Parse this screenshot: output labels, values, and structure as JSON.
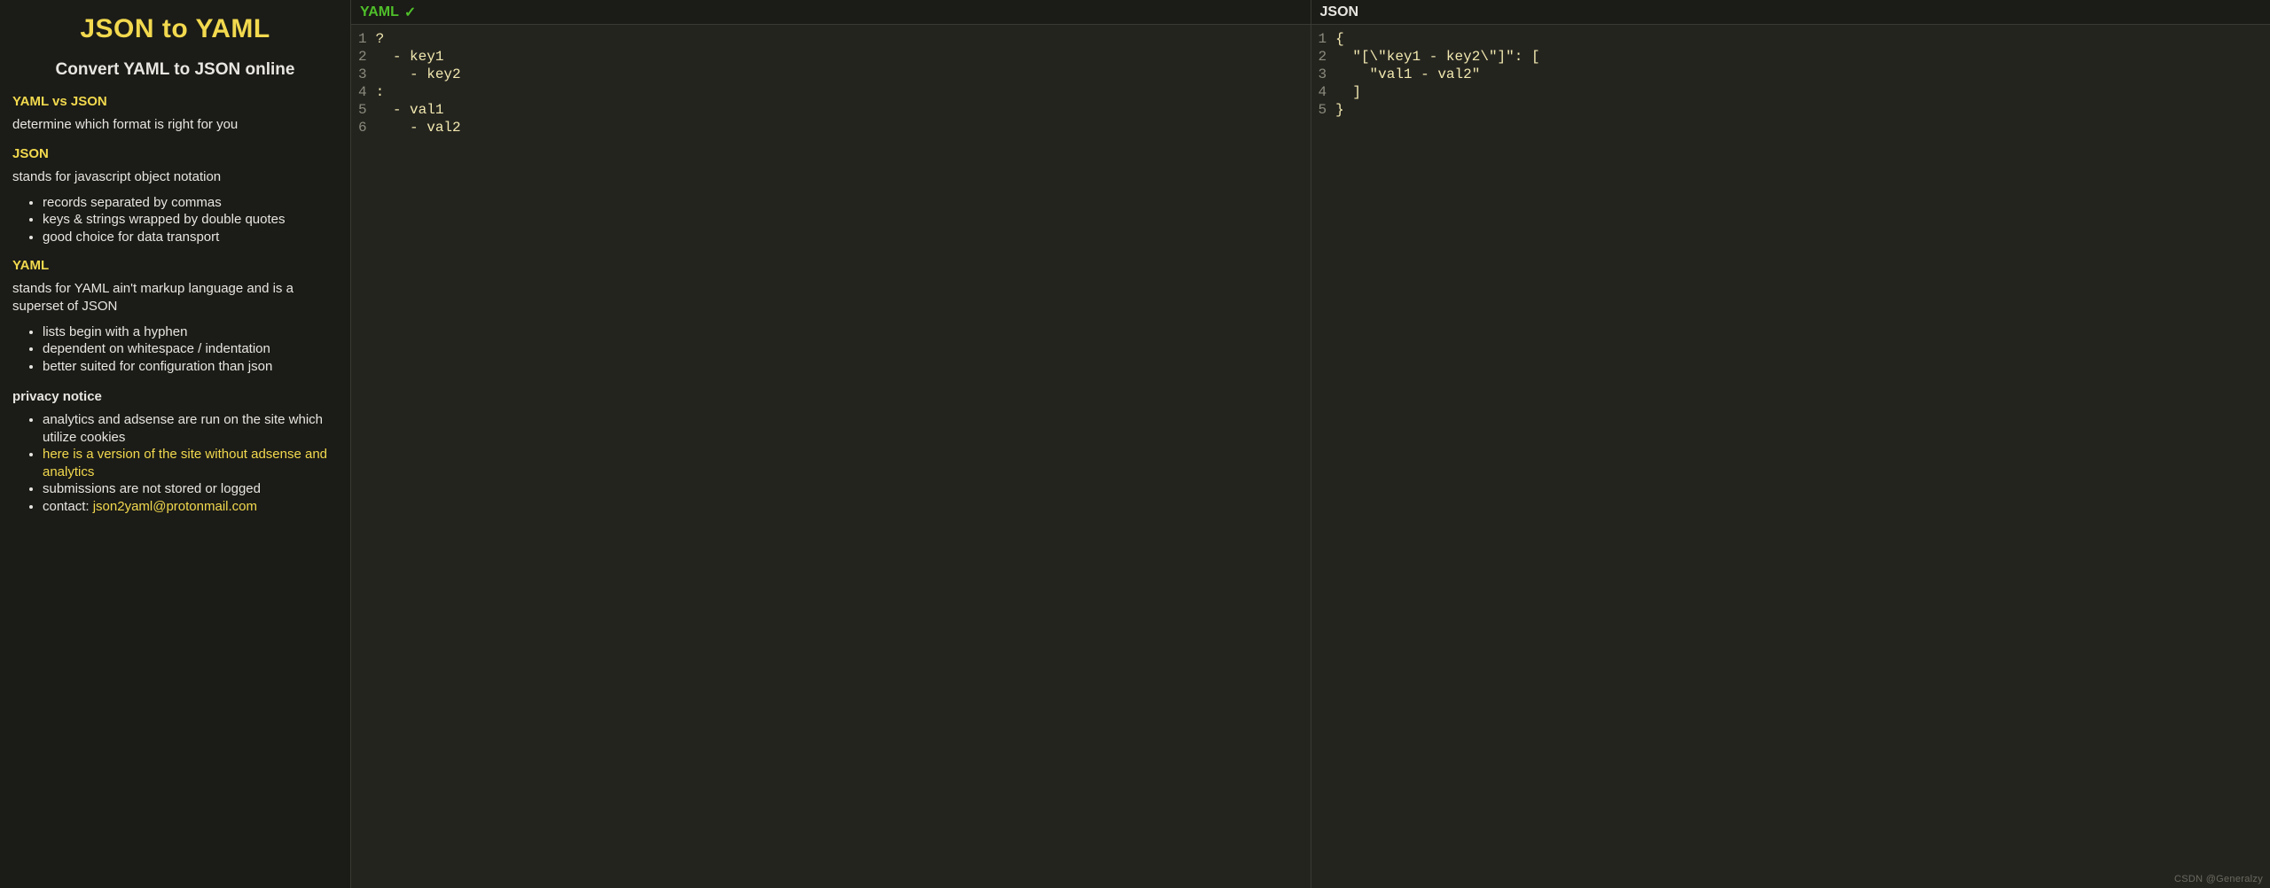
{
  "sidebar": {
    "title": "JSON to YAML",
    "subtitle": "Convert YAML to JSON online",
    "sections": {
      "vs_link": "YAML vs JSON",
      "vs_desc": "determine which format is right for you",
      "json_link": "JSON",
      "json_desc": "stands for javascript object notation",
      "json_bullets": [
        "records separated by commas",
        "keys & strings wrapped by double quotes",
        "good choice for data transport"
      ],
      "yaml_link": "YAML",
      "yaml_desc": "stands for YAML ain't markup language and is a superset of JSON",
      "yaml_bullets": [
        "lists begin with a hyphen",
        "dependent on whitespace / indentation",
        "better suited for configuration than json"
      ],
      "privacy_head": "privacy notice",
      "privacy_bullets": {
        "b0": "analytics and adsense are run on the site which utilize cookies",
        "b1_link": "here is a version of the site without adsense and analytics",
        "b2": "submissions are not stored or logged",
        "b3_prefix": "contact: ",
        "b3_link": "json2yaml@protonmail.com"
      }
    }
  },
  "panes": {
    "yaml": {
      "label": "YAML",
      "check": "✓",
      "lines": [
        "1",
        "2",
        "3",
        "4",
        "5",
        "6"
      ],
      "code": "?\n  - key1\n    - key2\n:\n  - val1\n    - val2"
    },
    "json": {
      "label": "JSON",
      "lines": [
        "1",
        "2",
        "3",
        "4",
        "5"
      ],
      "code": "{\n  \"[\\\"key1 - key2\\\"]\": [\n    \"val1 - val2\"\n  ]\n}"
    }
  },
  "watermark": "CSDN @Generalzy"
}
